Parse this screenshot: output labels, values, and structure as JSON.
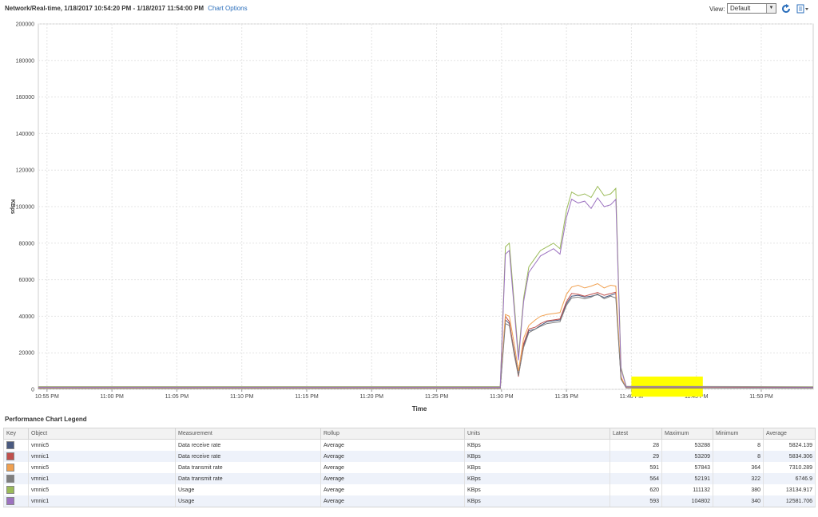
{
  "header": {
    "title": "Network/Real-time, 1/18/2017 10:54:20 PM - 1/18/2017 11:54:00 PM",
    "chart_options": "Chart Options",
    "view_label": "View:",
    "view_value": "Default"
  },
  "icons": {
    "refresh": "refresh-icon",
    "export": "export-icon",
    "dropdown": "chevron-down-icon"
  },
  "chart_data": {
    "type": "line",
    "title": "",
    "xlabel": "Time",
    "ylabel": "KBps",
    "ylim": [
      0,
      200000
    ],
    "yticks": [
      "0",
      "20000",
      "40000",
      "60000",
      "80000",
      "100000",
      "120000",
      "140000",
      "160000",
      "180000",
      "200000"
    ],
    "x_tick_labels": [
      "10:55 PM",
      "11:00 PM",
      "11:05 PM",
      "11:10 PM",
      "11:15 PM",
      "11:20 PM",
      "11:25 PM",
      "11:30 PM",
      "11:35 PM",
      "11:40 PM",
      "11:45 PM",
      "11:50 PM"
    ],
    "x_tick_minutes": [
      0,
      5,
      10,
      15,
      20,
      25,
      30,
      35,
      40,
      45,
      50,
      55
    ],
    "x_range_minutes": [
      -0.6667,
      59.0
    ],
    "grid": true,
    "highlight_minutes": [
      45.0,
      50.5
    ],
    "highlight_color": "#ffff00",
    "series": [
      {
        "name": "vmnic5 Data receive rate",
        "color": "#4a5a80",
        "points": [
          [
            -0.67,
            800
          ],
          [
            34.9,
            800
          ],
          [
            35.3,
            38000
          ],
          [
            35.6,
            36000
          ],
          [
            36.0,
            20000
          ],
          [
            36.3,
            8000
          ],
          [
            36.7,
            24000
          ],
          [
            37.1,
            32000
          ],
          [
            37.6,
            33000
          ],
          [
            38.0,
            35000
          ],
          [
            38.5,
            37000
          ],
          [
            39.0,
            37500
          ],
          [
            39.5,
            38000
          ],
          [
            40.0,
            47000
          ],
          [
            40.4,
            51000
          ],
          [
            40.9,
            51500
          ],
          [
            41.4,
            50500
          ],
          [
            41.9,
            51000
          ],
          [
            42.4,
            51800
          ],
          [
            42.9,
            50300
          ],
          [
            43.4,
            51500
          ],
          [
            43.8,
            52500
          ],
          [
            44.2,
            6000
          ],
          [
            44.6,
            1000
          ],
          [
            59.0,
            900
          ]
        ]
      },
      {
        "name": "vmnic1 Data receive rate",
        "color": "#c0504d",
        "points": [
          [
            -0.67,
            700
          ],
          [
            34.9,
            700
          ],
          [
            35.3,
            40000
          ],
          [
            35.6,
            37000
          ],
          [
            36.0,
            19000
          ],
          [
            36.3,
            7000
          ],
          [
            36.7,
            25000
          ],
          [
            37.1,
            33000
          ],
          [
            37.6,
            34000
          ],
          [
            38.0,
            36000
          ],
          [
            38.5,
            37500
          ],
          [
            39.0,
            38000
          ],
          [
            39.5,
            38500
          ],
          [
            40.0,
            48000
          ],
          [
            40.4,
            52500
          ],
          [
            40.9,
            52000
          ],
          [
            41.4,
            51000
          ],
          [
            41.9,
            52000
          ],
          [
            42.4,
            53000
          ],
          [
            42.9,
            51500
          ],
          [
            43.4,
            52500
          ],
          [
            43.8,
            53209
          ],
          [
            44.2,
            6500
          ],
          [
            44.6,
            900
          ],
          [
            59.0,
            800
          ]
        ]
      },
      {
        "name": "vmnic5 Data transmit rate",
        "color": "#f0a050",
        "points": [
          [
            -0.67,
            600
          ],
          [
            34.9,
            600
          ],
          [
            35.3,
            41000
          ],
          [
            35.6,
            40000
          ],
          [
            36.0,
            24000
          ],
          [
            36.3,
            10000
          ],
          [
            36.7,
            28000
          ],
          [
            37.1,
            35000
          ],
          [
            37.6,
            38000
          ],
          [
            38.0,
            40000
          ],
          [
            38.5,
            41000
          ],
          [
            39.0,
            41500
          ],
          [
            39.5,
            42000
          ],
          [
            40.0,
            52000
          ],
          [
            40.4,
            56000
          ],
          [
            40.9,
            57000
          ],
          [
            41.4,
            55500
          ],
          [
            41.9,
            56500
          ],
          [
            42.4,
            57843
          ],
          [
            42.9,
            55500
          ],
          [
            43.4,
            57000
          ],
          [
            43.8,
            56500
          ],
          [
            44.2,
            7000
          ],
          [
            44.6,
            800
          ],
          [
            59.0,
            700
          ]
        ]
      },
      {
        "name": "vmnic1 Data transmit rate",
        "color": "#7f7f7f",
        "points": [
          [
            -0.67,
            500
          ],
          [
            34.9,
            500
          ],
          [
            35.3,
            36000
          ],
          [
            35.6,
            35000
          ],
          [
            36.0,
            18000
          ],
          [
            36.3,
            7500
          ],
          [
            36.7,
            23000
          ],
          [
            37.1,
            31000
          ],
          [
            37.6,
            33000
          ],
          [
            38.0,
            34500
          ],
          [
            38.5,
            36000
          ],
          [
            39.0,
            36500
          ],
          [
            39.5,
            37000
          ],
          [
            40.0,
            46000
          ],
          [
            40.4,
            50000
          ],
          [
            40.9,
            50500
          ],
          [
            41.4,
            49500
          ],
          [
            41.9,
            50500
          ],
          [
            42.4,
            52191
          ],
          [
            42.9,
            49500
          ],
          [
            43.4,
            51000
          ],
          [
            43.8,
            50000
          ],
          [
            44.2,
            5500
          ],
          [
            44.6,
            800
          ],
          [
            59.0,
            600
          ]
        ]
      },
      {
        "name": "vmnic5 Usage",
        "color": "#9bbb59",
        "points": [
          [
            -0.67,
            1500
          ],
          [
            34.9,
            1500
          ],
          [
            35.3,
            78000
          ],
          [
            35.6,
            80000
          ],
          [
            36.0,
            45000
          ],
          [
            36.3,
            18000
          ],
          [
            36.7,
            50000
          ],
          [
            37.1,
            67000
          ],
          [
            37.6,
            72000
          ],
          [
            38.0,
            76000
          ],
          [
            38.5,
            78000
          ],
          [
            39.0,
            80000
          ],
          [
            39.5,
            77000
          ],
          [
            40.0,
            98000
          ],
          [
            40.4,
            108000
          ],
          [
            40.9,
            106000
          ],
          [
            41.4,
            107000
          ],
          [
            41.9,
            105000
          ],
          [
            42.4,
            111132
          ],
          [
            42.9,
            106000
          ],
          [
            43.4,
            107000
          ],
          [
            43.8,
            110000
          ],
          [
            44.2,
            12000
          ],
          [
            44.6,
            1700
          ],
          [
            59.0,
            1400
          ]
        ]
      },
      {
        "name": "vmnic1 Usage",
        "color": "#9c72c0",
        "points": [
          [
            -0.67,
            1200
          ],
          [
            34.9,
            1200
          ],
          [
            35.3,
            74000
          ],
          [
            35.6,
            76000
          ],
          [
            36.0,
            42000
          ],
          [
            36.3,
            16000
          ],
          [
            36.7,
            48000
          ],
          [
            37.1,
            64000
          ],
          [
            37.6,
            69000
          ],
          [
            38.0,
            73000
          ],
          [
            38.5,
            75000
          ],
          [
            39.0,
            77000
          ],
          [
            39.5,
            74000
          ],
          [
            40.0,
            94000
          ],
          [
            40.4,
            104000
          ],
          [
            40.9,
            102000
          ],
          [
            41.4,
            103000
          ],
          [
            41.9,
            99000
          ],
          [
            42.4,
            104802
          ],
          [
            42.9,
            100000
          ],
          [
            43.4,
            101000
          ],
          [
            43.8,
            104000
          ],
          [
            44.2,
            11000
          ],
          [
            44.6,
            1500
          ],
          [
            59.0,
            1200
          ]
        ]
      }
    ]
  },
  "legend": {
    "title": "Performance Chart Legend",
    "columns": [
      "Key",
      "Object",
      "Measurement",
      "Rollup",
      "Units",
      "Latest",
      "Maximum",
      "Minimum",
      "Average"
    ],
    "rows": [
      {
        "color": "#4a5a80",
        "object": "vmnic5",
        "measurement": "Data receive rate",
        "rollup": "Average",
        "units": "KBps",
        "latest": "28",
        "maximum": "53288",
        "minimum": "8",
        "average": "5824.139"
      },
      {
        "color": "#c0504d",
        "object": "vmnic1",
        "measurement": "Data receive rate",
        "rollup": "Average",
        "units": "KBps",
        "latest": "29",
        "maximum": "53209",
        "minimum": "8",
        "average": "5834.306"
      },
      {
        "color": "#f0a050",
        "object": "vmnic5",
        "measurement": "Data transmit rate",
        "rollup": "Average",
        "units": "KBps",
        "latest": "591",
        "maximum": "57843",
        "minimum": "364",
        "average": "7310.289"
      },
      {
        "color": "#7f7f7f",
        "object": "vmnic1",
        "measurement": "Data transmit rate",
        "rollup": "Average",
        "units": "KBps",
        "latest": "564",
        "maximum": "52191",
        "minimum": "322",
        "average": "6746.9"
      },
      {
        "color": "#9bbb59",
        "object": "vmnic5",
        "measurement": "Usage",
        "rollup": "Average",
        "units": "KBps",
        "latest": "620",
        "maximum": "111132",
        "minimum": "380",
        "average": "13134.917"
      },
      {
        "color": "#9c72c0",
        "object": "vmnic1",
        "measurement": "Usage",
        "rollup": "Average",
        "units": "KBps",
        "latest": "593",
        "maximum": "104802",
        "minimum": "340",
        "average": "12581.706"
      }
    ]
  }
}
